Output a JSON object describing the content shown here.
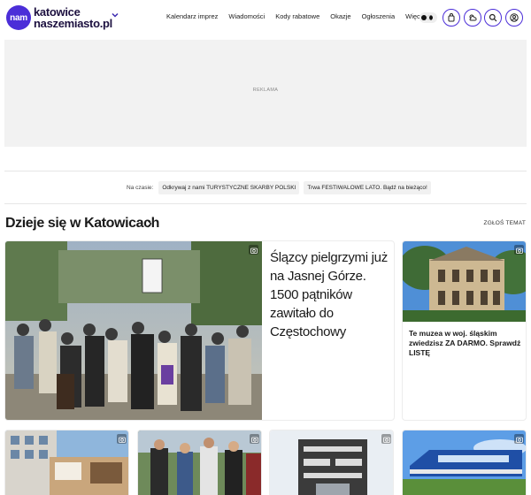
{
  "header": {
    "logo_badge": "nam",
    "logo_line1": "katowice",
    "logo_line2": "naszemiasto.pl",
    "nav": [
      {
        "label": "Kalendarz imprez"
      },
      {
        "label": "Wiadomości"
      },
      {
        "label": "Kody rabatowe"
      },
      {
        "label": "Okazje"
      },
      {
        "label": "Ogłoszenia"
      },
      {
        "label": "Więcej"
      }
    ],
    "icons": [
      "theme-toggle-icon",
      "bag-icon",
      "weather-icon",
      "search-icon",
      "user-icon"
    ]
  },
  "ad": {
    "label": "REKLAMA"
  },
  "hot": {
    "label": "Na czasie:",
    "chips": [
      "Odkrywaj z nami TURYSTYCZNE SKARBY POLSKI",
      "Trwa FESTIWALOWE LATO. Bądź na bieżąco!"
    ]
  },
  "section": {
    "title": "Dzieje się w Katowicach",
    "report": "ZGŁOŚ TEMAT"
  },
  "articles": {
    "main": {
      "title": "Ślązcy pielgrzymi już na Jasnej Górze. 1500 pątników zawitało do Częstochowy"
    },
    "side": {
      "title": "Te muzea w woj. śląskim zwiedzisz ZA DARMO. Sprawdź LISTĘ"
    }
  },
  "colors": {
    "brand": "#4b2ed8",
    "ad_bg": "#f2f2f2"
  }
}
